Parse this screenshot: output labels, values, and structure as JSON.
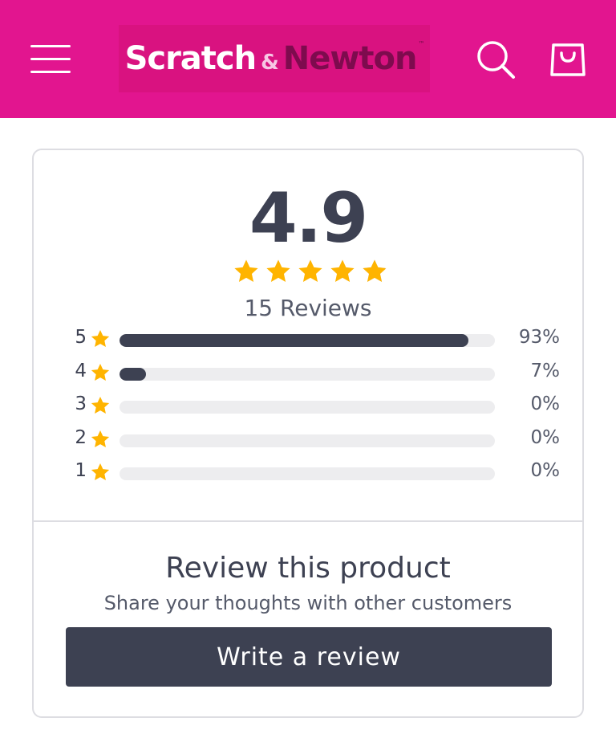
{
  "header": {
    "background": "#e2158f",
    "menu_icon": "hamburger-menu-icon",
    "logo": {
      "part1": "Scratch",
      "amp": "&",
      "part2": "Newton",
      "tm": "™"
    },
    "search_icon": "search-icon",
    "cart_icon": "shopping-bag-icon"
  },
  "summary": {
    "average": "4.9",
    "average_value": 4.9,
    "stars_max": 5,
    "reviews_label": "15 Reviews",
    "star_color": "#ffb400"
  },
  "distribution": [
    {
      "stars": "5",
      "percent_label": "93%",
      "fraction": 0.93
    },
    {
      "stars": "4",
      "percent_label": "7%",
      "fraction": 0.07
    },
    {
      "stars": "3",
      "percent_label": "0%",
      "fraction": 0.0
    },
    {
      "stars": "2",
      "percent_label": "0%",
      "fraction": 0.0
    },
    {
      "stars": "1",
      "percent_label": "0%",
      "fraction": 0.0
    }
  ],
  "review_cta": {
    "title": "Review this product",
    "subtitle": "Share your thoughts with other customers",
    "button_label": "Write a review"
  },
  "colors": {
    "brand_pink": "#e2158f",
    "dark": "#3d4152",
    "track": "#ededef",
    "star": "#ffb400"
  }
}
